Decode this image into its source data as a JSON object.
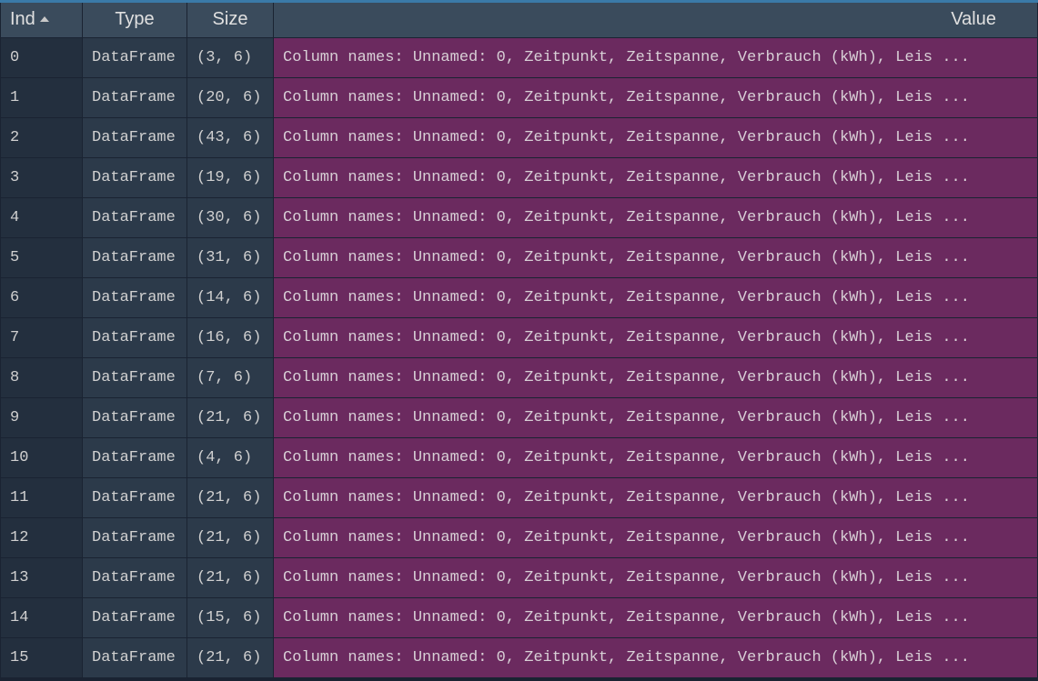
{
  "columns": {
    "index": "Ind",
    "type": "Type",
    "size": "Size",
    "value": "Value"
  },
  "sort": {
    "column": "index",
    "direction": "asc"
  },
  "rows": [
    {
      "index": "0",
      "type": "DataFrame",
      "size": "(3, 6)",
      "value": "Column names: Unnamed: 0, Zeitpunkt, Zeitspanne, Verbrauch (kWh), Leis ..."
    },
    {
      "index": "1",
      "type": "DataFrame",
      "size": "(20, 6)",
      "value": "Column names: Unnamed: 0, Zeitpunkt, Zeitspanne, Verbrauch (kWh), Leis ..."
    },
    {
      "index": "2",
      "type": "DataFrame",
      "size": "(43, 6)",
      "value": "Column names: Unnamed: 0, Zeitpunkt, Zeitspanne, Verbrauch (kWh), Leis ..."
    },
    {
      "index": "3",
      "type": "DataFrame",
      "size": "(19, 6)",
      "value": "Column names: Unnamed: 0, Zeitpunkt, Zeitspanne, Verbrauch (kWh), Leis ..."
    },
    {
      "index": "4",
      "type": "DataFrame",
      "size": "(30, 6)",
      "value": "Column names: Unnamed: 0, Zeitpunkt, Zeitspanne, Verbrauch (kWh), Leis ..."
    },
    {
      "index": "5",
      "type": "DataFrame",
      "size": "(31, 6)",
      "value": "Column names: Unnamed: 0, Zeitpunkt, Zeitspanne, Verbrauch (kWh), Leis ..."
    },
    {
      "index": "6",
      "type": "DataFrame",
      "size": "(14, 6)",
      "value": "Column names: Unnamed: 0, Zeitpunkt, Zeitspanne, Verbrauch (kWh), Leis ..."
    },
    {
      "index": "7",
      "type": "DataFrame",
      "size": "(16, 6)",
      "value": "Column names: Unnamed: 0, Zeitpunkt, Zeitspanne, Verbrauch (kWh), Leis ..."
    },
    {
      "index": "8",
      "type": "DataFrame",
      "size": "(7, 6)",
      "value": "Column names: Unnamed: 0, Zeitpunkt, Zeitspanne, Verbrauch (kWh), Leis ..."
    },
    {
      "index": "9",
      "type": "DataFrame",
      "size": "(21, 6)",
      "value": "Column names: Unnamed: 0, Zeitpunkt, Zeitspanne, Verbrauch (kWh), Leis ..."
    },
    {
      "index": "10",
      "type": "DataFrame",
      "size": "(4, 6)",
      "value": "Column names: Unnamed: 0, Zeitpunkt, Zeitspanne, Verbrauch (kWh), Leis ..."
    },
    {
      "index": "11",
      "type": "DataFrame",
      "size": "(21, 6)",
      "value": "Column names: Unnamed: 0, Zeitpunkt, Zeitspanne, Verbrauch (kWh), Leis ..."
    },
    {
      "index": "12",
      "type": "DataFrame",
      "size": "(21, 6)",
      "value": "Column names: Unnamed: 0, Zeitpunkt, Zeitspanne, Verbrauch (kWh), Leis ..."
    },
    {
      "index": "13",
      "type": "DataFrame",
      "size": "(21, 6)",
      "value": "Column names: Unnamed: 0, Zeitpunkt, Zeitspanne, Verbrauch (kWh), Leis ..."
    },
    {
      "index": "14",
      "type": "DataFrame",
      "size": "(15, 6)",
      "value": "Column names: Unnamed: 0, Zeitpunkt, Zeitspanne, Verbrauch (kWh), Leis ..."
    },
    {
      "index": "15",
      "type": "DataFrame",
      "size": "(21, 6)",
      "value": "Column names: Unnamed: 0, Zeitpunkt, Zeitspanne, Verbrauch (kWh), Leis ..."
    }
  ]
}
